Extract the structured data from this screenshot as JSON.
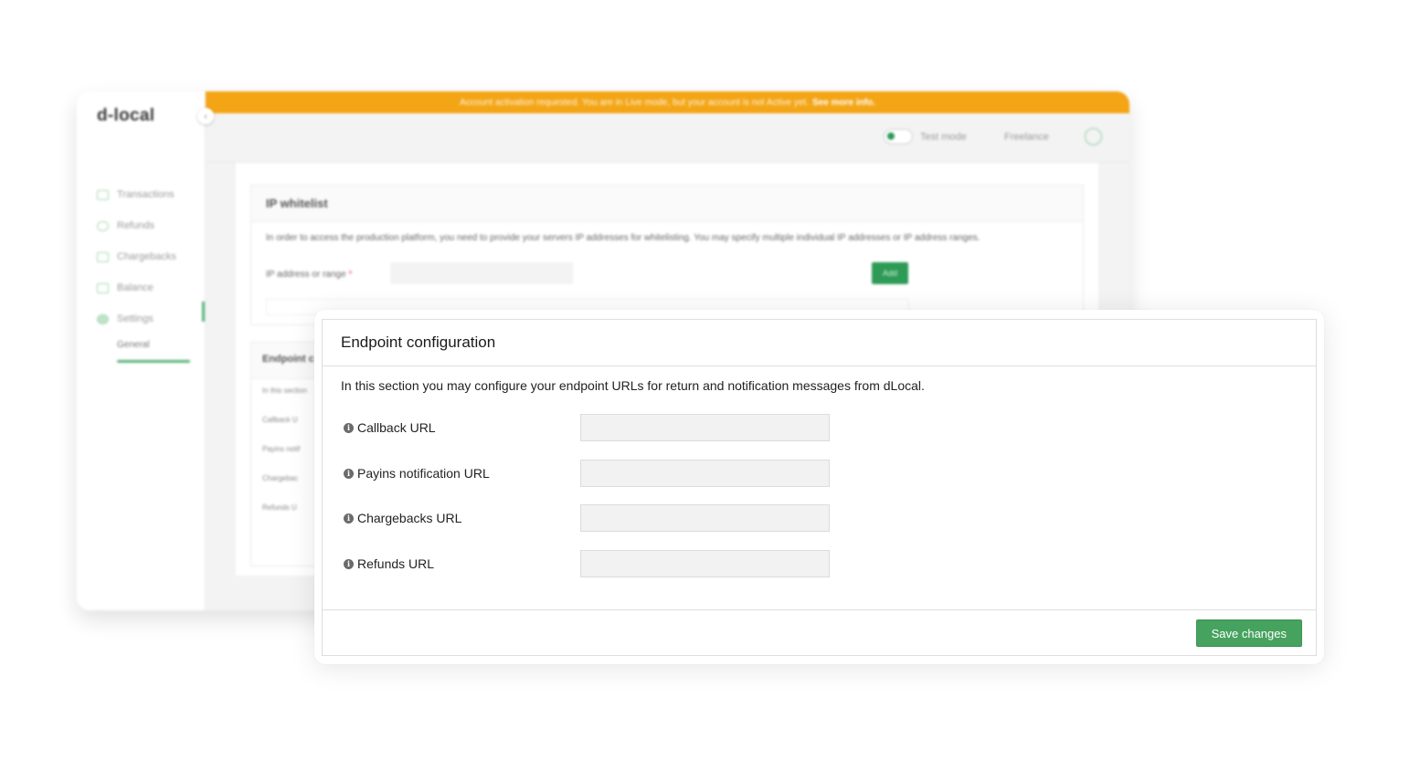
{
  "background_app": {
    "logo": "d-local",
    "collapse_icon": "chevron-left-icon",
    "banner": {
      "text": "Account activation requested. You are in Live mode, but your account is not Active yet.",
      "link": "See more info."
    },
    "topbar": {
      "test_mode_label": "Test mode",
      "account_name": "Freelance"
    },
    "sidebar": {
      "items": [
        {
          "label": "Transactions",
          "icon": "transactions-icon"
        },
        {
          "label": "Refunds",
          "icon": "refunds-icon"
        },
        {
          "label": "Chargebacks",
          "icon": "chargebacks-icon"
        },
        {
          "label": "Balance",
          "icon": "balance-icon"
        },
        {
          "label": "Settings",
          "icon": "settings-icon"
        }
      ],
      "sub_item": "General"
    },
    "ip_whitelist": {
      "title": "IP whitelist",
      "description": "In order to access the production platform, you need to provide your servers IP addresses for whitelisting. You may specify multiple individual IP addresses or IP address ranges.",
      "field_label": "IP address or range",
      "required_mark": "*",
      "add_label": "Add"
    },
    "endpoint_card": {
      "title": "Endpoint c",
      "lines": [
        "In this section",
        "Callback U",
        "Payins notif",
        "Chargebac",
        "Refunds U"
      ]
    }
  },
  "modal": {
    "title": "Endpoint configuration",
    "description": "In this section you may configure your endpoint URLs for return and notification messages from dLocal.",
    "fields": [
      {
        "label": "Callback URL",
        "value": "",
        "placeholder": ""
      },
      {
        "label": "Payins notification URL",
        "value": "",
        "placeholder": ""
      },
      {
        "label": "Chargebacks URL",
        "value": "",
        "placeholder": ""
      },
      {
        "label": "Refunds URL",
        "value": "",
        "placeholder": ""
      }
    ],
    "info_glyph": "i",
    "save_label": "Save changes"
  },
  "colors": {
    "banner": "#f3a516",
    "accent_green": "#46a25f"
  }
}
